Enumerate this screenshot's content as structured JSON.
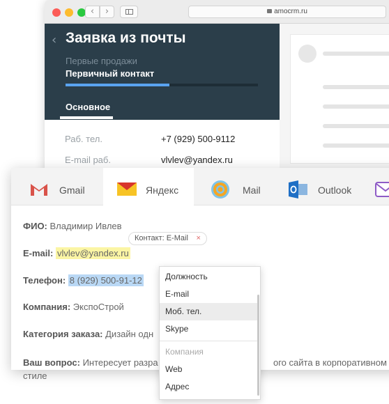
{
  "browser": {
    "url": "amocrm.ru"
  },
  "crm": {
    "title": "Заявка из почты",
    "pipeline": "Первые продажи",
    "stage": "Первичный контакт",
    "stage_progress_percent": 54,
    "tab": "Основное",
    "fields": [
      {
        "label": "Раб. тел.",
        "value": "+7 (929) 500-9112"
      },
      {
        "label": "E-mail раб.",
        "value": "vlvlev@yandex.ru"
      }
    ]
  },
  "mail": {
    "tabs": [
      {
        "label": "Gmail",
        "icon": "gmail-icon",
        "active": false
      },
      {
        "label": "Яндекс",
        "icon": "yandex-mail-icon",
        "active": true
      },
      {
        "label": "Mail",
        "icon": "mail-ru-icon",
        "active": false
      },
      {
        "label": "Outlook",
        "icon": "outlook-icon",
        "active": false
      }
    ],
    "lines": {
      "fio_label": "ФИО:",
      "fio_value": "Владимир Ивлев",
      "email_label": "E-mail:",
      "email_value": "vlvlev@yandex.ru",
      "phone_label": "Телефон:",
      "phone_value": "8 (929) 500-91-12",
      "company_label": "Компания:",
      "company_value": "ЭкспоСтрой",
      "category_label": "Категория заказа:",
      "category_value": "Дизайн одн",
      "question_label": "Ваш вопрос:",
      "question_value_a": "Интересует разра",
      "question_value_b": "ого сайта в корпоративном",
      "question_value_c": "стиле"
    },
    "chip": "Контакт: E-Mail",
    "chip_close": "×"
  },
  "dropdown": {
    "items": [
      "Должность",
      "E-mail",
      "Моб. тел.",
      "Skype"
    ],
    "group": "Компания",
    "group_items": [
      "Web",
      "Адрес"
    ]
  },
  "colors": {
    "crm_header": "#2b3e4a",
    "progress": "#5aa3f0",
    "yellow_highlight": "#fbf5a4",
    "blue_highlight": "#b9d8f5"
  }
}
